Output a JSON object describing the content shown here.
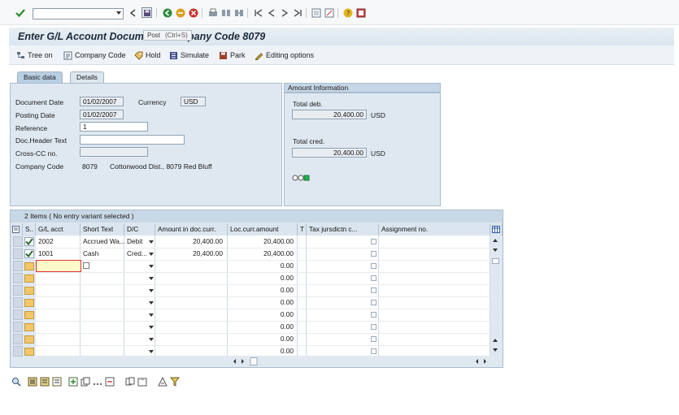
{
  "toolbar": {
    "command_value": "",
    "tooltip_label": "Post",
    "tooltip_shortcut": "(Ctrl+S)"
  },
  "title": "Enter G/L Account Document: Company Code 8079",
  "app_toolbar": {
    "tree_on": "Tree on",
    "company_code": "Company Code",
    "hold": "Hold",
    "simulate": "Simulate",
    "park": "Park",
    "editing_options": "Editing options"
  },
  "tabs": {
    "basic_data": "Basic data",
    "details": "Details"
  },
  "basic": {
    "document_date_label": "Document Date",
    "document_date": "01/02/2007",
    "currency_label": "Currency",
    "currency": "USD",
    "posting_date_label": "Posting Date",
    "posting_date": "01/02/2007",
    "reference_label": "Reference",
    "reference": "1",
    "doc_header_label": "Doc.Header Text",
    "doc_header": "",
    "cross_cc_label": "Cross-CC no.",
    "cross_cc": "",
    "company_code_label": "Company Code",
    "company_code": "8079",
    "company_name": "Cottonwood Dist., 8079 Red Bluff"
  },
  "amount": {
    "header": "Amount Information",
    "total_deb_label": "Total deb.",
    "total_deb": "20,400.00",
    "total_deb_currency": "USD",
    "total_cred_label": "Total cred.",
    "total_cred": "20,400.00",
    "total_cred_currency": "USD",
    "status_color": "#22b14c"
  },
  "items": {
    "title": "2 Items ( No entry variant selected )",
    "columns": {
      "s": "S..",
      "gl_acct": "G/L acct",
      "short_text": "Short Text",
      "dc": "D/C",
      "amount_doc": "Amount in doc.curr.",
      "loc_amount": "Loc.curr.amount",
      "t": "T",
      "tax_juris": "Tax jursdictn c...",
      "assignment": "Assignment no."
    },
    "rows": [
      {
        "gl": "2002",
        "text": "Accrued Wa...",
        "dc": "Debit",
        "amount": "20,400.00",
        "loc": "20,400.00"
      },
      {
        "gl": "1001",
        "text": "Cash",
        "dc": "Cred...",
        "amount": "20,400.00",
        "loc": "20,400.00"
      },
      {
        "gl": "",
        "text": "",
        "dc": "",
        "amount": "",
        "loc": "0.00"
      },
      {
        "gl": "",
        "text": "",
        "dc": "",
        "amount": "",
        "loc": "0.00"
      },
      {
        "gl": "",
        "text": "",
        "dc": "",
        "amount": "",
        "loc": "0.00"
      },
      {
        "gl": "",
        "text": "",
        "dc": "",
        "amount": "",
        "loc": "0.00"
      },
      {
        "gl": "",
        "text": "",
        "dc": "",
        "amount": "",
        "loc": "0.00"
      },
      {
        "gl": "",
        "text": "",
        "dc": "",
        "amount": "",
        "loc": "0.00"
      },
      {
        "gl": "",
        "text": "",
        "dc": "",
        "amount": "",
        "loc": "0.00"
      },
      {
        "gl": "",
        "text": "",
        "dc": "",
        "amount": "",
        "loc": "0.00"
      }
    ]
  }
}
